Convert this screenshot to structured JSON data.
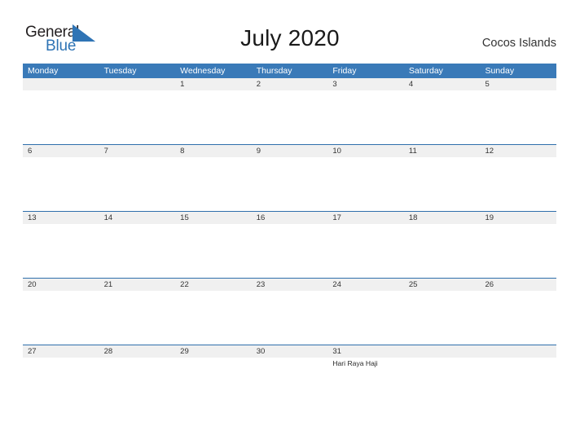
{
  "brand": {
    "name_part1": "General",
    "name_part2": "Blue",
    "triangle_color": "#2f74b5",
    "text_color_primary": "#231f20",
    "text_color_secondary": "#2f74b5"
  },
  "header": {
    "title": "July 2020",
    "location": "Cocos Islands"
  },
  "theme": {
    "header_blue": "#3a7ab8",
    "rule_blue": "#2f6fab",
    "band_gray": "#f0f0f0",
    "page_background": "#ffffff"
  },
  "calendar": {
    "weekdays": [
      "Monday",
      "Tuesday",
      "Wednesday",
      "Thursday",
      "Friday",
      "Saturday",
      "Sunday"
    ],
    "weeks": [
      {
        "days": [
          {
            "number": "",
            "events": []
          },
          {
            "number": "",
            "events": []
          },
          {
            "number": "1",
            "events": []
          },
          {
            "number": "2",
            "events": []
          },
          {
            "number": "3",
            "events": []
          },
          {
            "number": "4",
            "events": []
          },
          {
            "number": "5",
            "events": []
          }
        ]
      },
      {
        "days": [
          {
            "number": "6",
            "events": []
          },
          {
            "number": "7",
            "events": []
          },
          {
            "number": "8",
            "events": []
          },
          {
            "number": "9",
            "events": []
          },
          {
            "number": "10",
            "events": []
          },
          {
            "number": "11",
            "events": []
          },
          {
            "number": "12",
            "events": []
          }
        ]
      },
      {
        "days": [
          {
            "number": "13",
            "events": []
          },
          {
            "number": "14",
            "events": []
          },
          {
            "number": "15",
            "events": []
          },
          {
            "number": "16",
            "events": []
          },
          {
            "number": "17",
            "events": []
          },
          {
            "number": "18",
            "events": []
          },
          {
            "number": "19",
            "events": []
          }
        ]
      },
      {
        "days": [
          {
            "number": "20",
            "events": []
          },
          {
            "number": "21",
            "events": []
          },
          {
            "number": "22",
            "events": []
          },
          {
            "number": "23",
            "events": []
          },
          {
            "number": "24",
            "events": []
          },
          {
            "number": "25",
            "events": []
          },
          {
            "number": "26",
            "events": []
          }
        ]
      },
      {
        "days": [
          {
            "number": "27",
            "events": []
          },
          {
            "number": "28",
            "events": []
          },
          {
            "number": "29",
            "events": []
          },
          {
            "number": "30",
            "events": []
          },
          {
            "number": "31",
            "events": [
              "Hari Raya Haji"
            ]
          },
          {
            "number": "",
            "events": []
          },
          {
            "number": "",
            "events": []
          }
        ]
      }
    ]
  }
}
